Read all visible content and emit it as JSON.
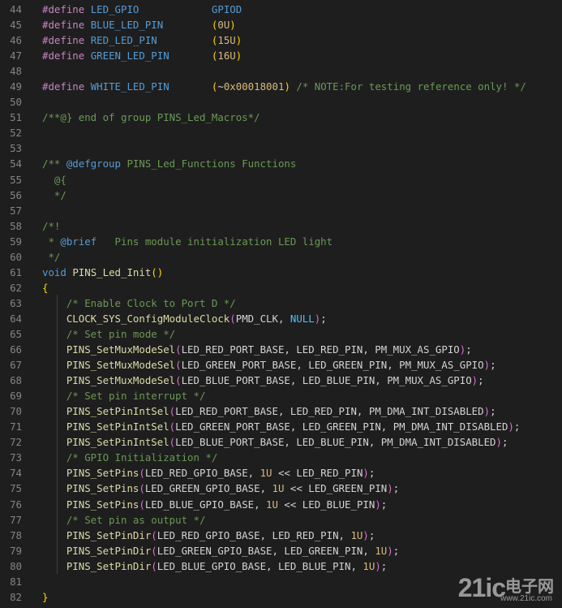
{
  "editor": {
    "lines": [
      {
        "n": "44",
        "tokens": [
          {
            "c": "pp",
            "t": "#define "
          },
          {
            "c": "mac",
            "t": "LED_GPIO"
          },
          {
            "c": "pn",
            "t": "            "
          },
          {
            "c": "mac",
            "t": "GPIOD"
          }
        ]
      },
      {
        "n": "45",
        "tokens": [
          {
            "c": "pp",
            "t": "#define "
          },
          {
            "c": "mac",
            "t": "BLUE_LED_PIN"
          },
          {
            "c": "pn",
            "t": "        "
          },
          {
            "c": "p1",
            "t": "("
          },
          {
            "c": "num",
            "t": "0U"
          },
          {
            "c": "p1",
            "t": ")"
          }
        ]
      },
      {
        "n": "46",
        "tokens": [
          {
            "c": "pp",
            "t": "#define "
          },
          {
            "c": "mac",
            "t": "RED_LED_PIN"
          },
          {
            "c": "pn",
            "t": "         "
          },
          {
            "c": "p1",
            "t": "("
          },
          {
            "c": "num",
            "t": "15U"
          },
          {
            "c": "p1",
            "t": ")"
          }
        ]
      },
      {
        "n": "47",
        "tokens": [
          {
            "c": "pp",
            "t": "#define "
          },
          {
            "c": "mac",
            "t": "GREEN_LED_PIN"
          },
          {
            "c": "pn",
            "t": "       "
          },
          {
            "c": "p1",
            "t": "("
          },
          {
            "c": "num",
            "t": "16U"
          },
          {
            "c": "p1",
            "t": ")"
          }
        ]
      },
      {
        "n": "48",
        "tokens": []
      },
      {
        "n": "49",
        "tokens": [
          {
            "c": "pp",
            "t": "#define "
          },
          {
            "c": "mac",
            "t": "WHITE_LED_PIN"
          },
          {
            "c": "pn",
            "t": "       "
          },
          {
            "c": "p1",
            "t": "("
          },
          {
            "c": "pn",
            "t": "~"
          },
          {
            "c": "num",
            "t": "0x00018001"
          },
          {
            "c": "p1",
            "t": ")"
          },
          {
            "c": "pn",
            "t": " "
          },
          {
            "c": "cm",
            "t": "/* NOTE:For testing reference only! */"
          }
        ]
      },
      {
        "n": "50",
        "tokens": []
      },
      {
        "n": "51",
        "tokens": [
          {
            "c": "cm",
            "t": "/**@} end of group PINS_Led_Macros*/"
          }
        ]
      },
      {
        "n": "52",
        "tokens": []
      },
      {
        "n": "53",
        "tokens": []
      },
      {
        "n": "54",
        "tokens": [
          {
            "c": "cm",
            "t": "/** "
          },
          {
            "c": "tag",
            "t": "@defgroup"
          },
          {
            "c": "cm",
            "t": " PINS_Led_Functions Functions"
          }
        ]
      },
      {
        "n": "55",
        "tokens": [
          {
            "c": "cm",
            "t": "  @{"
          }
        ]
      },
      {
        "n": "56",
        "tokens": [
          {
            "c": "cm",
            "t": "  */"
          }
        ]
      },
      {
        "n": "57",
        "tokens": []
      },
      {
        "n": "58",
        "tokens": [
          {
            "c": "cm",
            "t": "/*!"
          }
        ]
      },
      {
        "n": "59",
        "tokens": [
          {
            "c": "cm",
            "t": " * "
          },
          {
            "c": "tag",
            "t": "@brief"
          },
          {
            "c": "cm",
            "t": "   Pins module initialization LED light"
          }
        ]
      },
      {
        "n": "60",
        "tokens": [
          {
            "c": "cm",
            "t": " */"
          }
        ]
      },
      {
        "n": "61",
        "tokens": [
          {
            "c": "kw",
            "t": "void"
          },
          {
            "c": "pn",
            "t": " "
          },
          {
            "c": "fn",
            "t": "PINS_Led_Init"
          },
          {
            "c": "p1",
            "t": "()"
          }
        ]
      },
      {
        "n": "62",
        "tokens": [
          {
            "c": "p1",
            "t": "{"
          }
        ]
      },
      {
        "n": "63",
        "tokens": [
          {
            "c": "pn",
            "t": "    "
          },
          {
            "c": "cm",
            "t": "/* Enable Clock to Port D */"
          }
        ]
      },
      {
        "n": "64",
        "tokens": [
          {
            "c": "pn",
            "t": "    "
          },
          {
            "c": "fn",
            "t": "CLOCK_SYS_ConfigModuleClock"
          },
          {
            "c": "p2",
            "t": "("
          },
          {
            "c": "pn",
            "t": "PMD_CLK, "
          },
          {
            "c": "mv",
            "t": "NULL"
          },
          {
            "c": "p2",
            "t": ")"
          },
          {
            "c": "pn",
            "t": ";"
          }
        ]
      },
      {
        "n": "65",
        "tokens": [
          {
            "c": "pn",
            "t": "    "
          },
          {
            "c": "cm",
            "t": "/* Set pin mode */"
          }
        ]
      },
      {
        "n": "66",
        "tokens": [
          {
            "c": "pn",
            "t": "    "
          },
          {
            "c": "fn",
            "t": "PINS_SetMuxModeSel"
          },
          {
            "c": "p2",
            "t": "("
          },
          {
            "c": "pn",
            "t": "LED_RED_PORT_BASE, LED_RED_PIN, PM_MUX_AS_GPIO"
          },
          {
            "c": "p2",
            "t": ")"
          },
          {
            "c": "pn",
            "t": ";"
          }
        ]
      },
      {
        "n": "67",
        "tokens": [
          {
            "c": "pn",
            "t": "    "
          },
          {
            "c": "fn",
            "t": "PINS_SetMuxModeSel"
          },
          {
            "c": "p2",
            "t": "("
          },
          {
            "c": "pn",
            "t": "LED_GREEN_PORT_BASE, LED_GREEN_PIN, PM_MUX_AS_GPIO"
          },
          {
            "c": "p2",
            "t": ")"
          },
          {
            "c": "pn",
            "t": ";"
          }
        ]
      },
      {
        "n": "68",
        "tokens": [
          {
            "c": "pn",
            "t": "    "
          },
          {
            "c": "fn",
            "t": "PINS_SetMuxModeSel"
          },
          {
            "c": "p2",
            "t": "("
          },
          {
            "c": "pn",
            "t": "LED_BLUE_PORT_BASE, LED_BLUE_PIN, PM_MUX_AS_GPIO"
          },
          {
            "c": "p2",
            "t": ")"
          },
          {
            "c": "pn",
            "t": ";"
          }
        ]
      },
      {
        "n": "69",
        "tokens": [
          {
            "c": "pn",
            "t": "    "
          },
          {
            "c": "cm",
            "t": "/* Set pin interrupt */"
          }
        ]
      },
      {
        "n": "70",
        "tokens": [
          {
            "c": "pn",
            "t": "    "
          },
          {
            "c": "fn",
            "t": "PINS_SetPinIntSel"
          },
          {
            "c": "p2",
            "t": "("
          },
          {
            "c": "pn",
            "t": "LED_RED_PORT_BASE, LED_RED_PIN, PM_DMA_INT_DISABLED"
          },
          {
            "c": "p2",
            "t": ")"
          },
          {
            "c": "pn",
            "t": ";"
          }
        ]
      },
      {
        "n": "71",
        "tokens": [
          {
            "c": "pn",
            "t": "    "
          },
          {
            "c": "fn",
            "t": "PINS_SetPinIntSel"
          },
          {
            "c": "p2",
            "t": "("
          },
          {
            "c": "pn",
            "t": "LED_GREEN_PORT_BASE, LED_GREEN_PIN, PM_DMA_INT_DISABLED"
          },
          {
            "c": "p2",
            "t": ")"
          },
          {
            "c": "pn",
            "t": ";"
          }
        ]
      },
      {
        "n": "72",
        "tokens": [
          {
            "c": "pn",
            "t": "    "
          },
          {
            "c": "fn",
            "t": "PINS_SetPinIntSel"
          },
          {
            "c": "p2",
            "t": "("
          },
          {
            "c": "pn",
            "t": "LED_BLUE_PORT_BASE, LED_BLUE_PIN, PM_DMA_INT_DISABLED"
          },
          {
            "c": "p2",
            "t": ")"
          },
          {
            "c": "pn",
            "t": ";"
          }
        ]
      },
      {
        "n": "73",
        "tokens": [
          {
            "c": "pn",
            "t": "    "
          },
          {
            "c": "cm",
            "t": "/* GPIO Initialization */"
          }
        ]
      },
      {
        "n": "74",
        "tokens": [
          {
            "c": "pn",
            "t": "    "
          },
          {
            "c": "fn",
            "t": "PINS_SetPins"
          },
          {
            "c": "p2",
            "t": "("
          },
          {
            "c": "pn",
            "t": "LED_RED_GPIO_BASE, "
          },
          {
            "c": "num",
            "t": "1U"
          },
          {
            "c": "pn",
            "t": " << LED_RED_PIN"
          },
          {
            "c": "p2",
            "t": ")"
          },
          {
            "c": "pn",
            "t": ";"
          }
        ]
      },
      {
        "n": "75",
        "tokens": [
          {
            "c": "pn",
            "t": "    "
          },
          {
            "c": "fn",
            "t": "PINS_SetPins"
          },
          {
            "c": "p2",
            "t": "("
          },
          {
            "c": "pn",
            "t": "LED_GREEN_GPIO_BASE, "
          },
          {
            "c": "num",
            "t": "1U"
          },
          {
            "c": "pn",
            "t": " << LED_GREEN_PIN"
          },
          {
            "c": "p2",
            "t": ")"
          },
          {
            "c": "pn",
            "t": ";"
          }
        ]
      },
      {
        "n": "76",
        "tokens": [
          {
            "c": "pn",
            "t": "    "
          },
          {
            "c": "fn",
            "t": "PINS_SetPins"
          },
          {
            "c": "p2",
            "t": "("
          },
          {
            "c": "pn",
            "t": "LED_BLUE_GPIO_BASE, "
          },
          {
            "c": "num",
            "t": "1U"
          },
          {
            "c": "pn",
            "t": " << LED_BLUE_PIN"
          },
          {
            "c": "p2",
            "t": ")"
          },
          {
            "c": "pn",
            "t": ";"
          }
        ]
      },
      {
        "n": "77",
        "tokens": [
          {
            "c": "pn",
            "t": "    "
          },
          {
            "c": "cm",
            "t": "/* Set pin as output */"
          }
        ]
      },
      {
        "n": "78",
        "tokens": [
          {
            "c": "pn",
            "t": "    "
          },
          {
            "c": "fn",
            "t": "PINS_SetPinDir"
          },
          {
            "c": "p2",
            "t": "("
          },
          {
            "c": "pn",
            "t": "LED_RED_GPIO_BASE, LED_RED_PIN, "
          },
          {
            "c": "num",
            "t": "1U"
          },
          {
            "c": "p2",
            "t": ")"
          },
          {
            "c": "pn",
            "t": ";"
          }
        ]
      },
      {
        "n": "79",
        "tokens": [
          {
            "c": "pn",
            "t": "    "
          },
          {
            "c": "fn",
            "t": "PINS_SetPinDir"
          },
          {
            "c": "p2",
            "t": "("
          },
          {
            "c": "pn",
            "t": "LED_GREEN_GPIO_BASE, LED_GREEN_PIN, "
          },
          {
            "c": "num",
            "t": "1U"
          },
          {
            "c": "p2",
            "t": ")"
          },
          {
            "c": "pn",
            "t": ";"
          }
        ]
      },
      {
        "n": "80",
        "tokens": [
          {
            "c": "pn",
            "t": "    "
          },
          {
            "c": "fn",
            "t": "PINS_SetPinDir"
          },
          {
            "c": "p2",
            "t": "("
          },
          {
            "c": "pn",
            "t": "LED_BLUE_GPIO_BASE, LED_BLUE_PIN, "
          },
          {
            "c": "num",
            "t": "1U"
          },
          {
            "c": "p2",
            "t": ")"
          },
          {
            "c": "pn",
            "t": ";"
          }
        ]
      },
      {
        "n": "81",
        "tokens": []
      },
      {
        "n": "82",
        "tokens": [
          {
            "c": "p1",
            "t": "}"
          }
        ]
      }
    ]
  },
  "watermark": {
    "brand": "21ic",
    "cn": "电子网",
    "url": "www.21ic.com"
  },
  "colors": {
    "background": "#1e1e1e",
    "line_number": "#858585",
    "preprocessor": "#c586c0",
    "macro": "#569cd6",
    "number": "#d7ba7d",
    "comment": "#6a9955",
    "function": "#dcdcaa",
    "bracket_1": "#ffd700",
    "bracket_2": "#da70d6",
    "constant": "#4fc1ff"
  }
}
